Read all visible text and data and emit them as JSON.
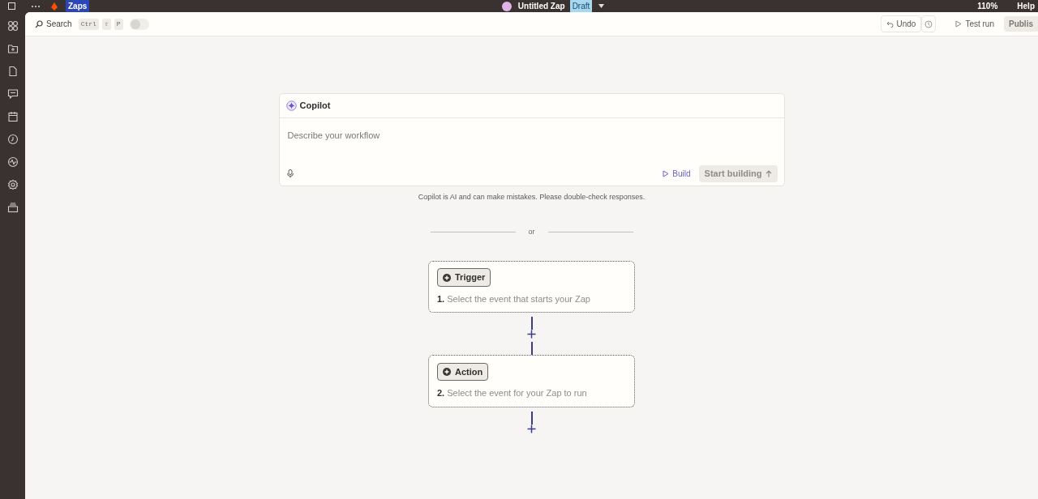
{
  "top_bar": {
    "section": "Zaps",
    "zap_title": "Untitled Zap",
    "status_badge": "Draft",
    "zoom": "110%",
    "help": "Help"
  },
  "rail": {
    "items": [
      {
        "kind": "apps"
      },
      {
        "kind": "folder"
      },
      {
        "kind": "file"
      },
      {
        "kind": "chat"
      },
      {
        "kind": "calendar"
      },
      {
        "kind": "clock"
      },
      {
        "kind": "activity"
      },
      {
        "kind": "gear"
      },
      {
        "kind": "archive"
      }
    ]
  },
  "toolbar": {
    "search": "Search",
    "keys": [
      "Ctrl",
      "⇧",
      "P"
    ],
    "toggle_on": false,
    "undo": "Undo",
    "test_run": "Test run",
    "publish": "Publis"
  },
  "copilot": {
    "title": "Copilot",
    "placeholder": "Describe your workflow",
    "build": "Build",
    "start": "Start building",
    "disclaimer": "Copilot is AI and can make mistakes. Please double-check responses."
  },
  "divider_text": "or",
  "steps": [
    {
      "label": "Trigger",
      "number": "1.",
      "description": "Select the event that starts your Zap"
    },
    {
      "label": "Action",
      "number": "2.",
      "description": "Select the event for your Zap to run"
    }
  ]
}
